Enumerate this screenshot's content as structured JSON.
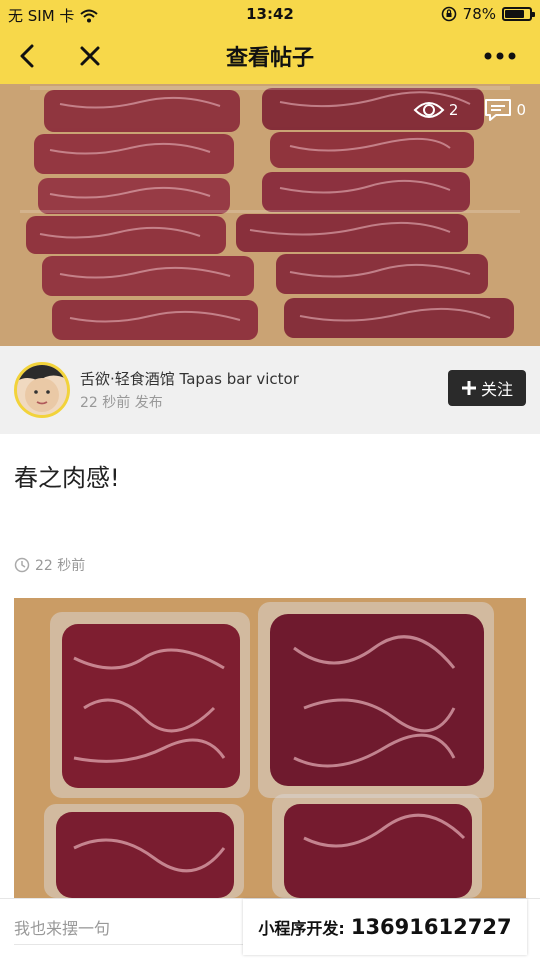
{
  "status": {
    "carrier": "无 SIM 卡",
    "time": "13:42",
    "battery": "78%",
    "battery_level": 0.78
  },
  "nav": {
    "title": "查看帖子",
    "back_icon": "chevron-left-icon",
    "close_icon": "close-icon",
    "more_icon": "more-icon"
  },
  "hero": {
    "views": "2",
    "comments": "0"
  },
  "author": {
    "name": "舌欲·轻食酒馆 Tapas bar victor",
    "time": "22 秒前 发布",
    "follow_label": "关注"
  },
  "post": {
    "title": "春之肉感!",
    "time": "22 秒前"
  },
  "comment": {
    "placeholder": "我也来摆一句"
  },
  "promo": {
    "label": "小程序开发:",
    "phone": "13691612727"
  },
  "colors": {
    "brand_yellow": "#f7d84a",
    "follow_button": "#2a2a2a"
  }
}
